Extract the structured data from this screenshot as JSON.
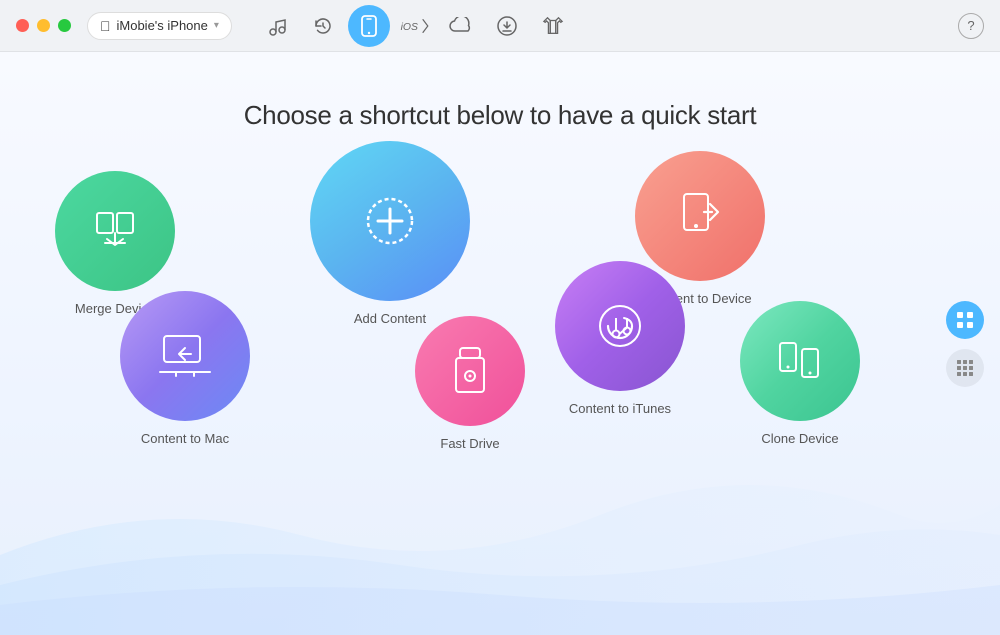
{
  "titlebar": {
    "device_name": "iMobie's iPhone",
    "chevron": "▾",
    "help_label": "?"
  },
  "toolbar": {
    "buttons": [
      {
        "id": "music",
        "label": "♫",
        "active": false,
        "symbol": "music"
      },
      {
        "id": "history",
        "label": "↺",
        "active": false,
        "symbol": "history"
      },
      {
        "id": "device",
        "label": "📱",
        "active": true,
        "symbol": "device"
      },
      {
        "id": "ios",
        "label": "iOS",
        "active": false,
        "symbol": "ios"
      },
      {
        "id": "cloud",
        "label": "☁",
        "active": false,
        "symbol": "cloud"
      },
      {
        "id": "download",
        "label": "↓",
        "active": false,
        "symbol": "download"
      },
      {
        "id": "transfer",
        "label": "⊡",
        "active": false,
        "symbol": "transfer"
      }
    ]
  },
  "main": {
    "page_title": "Choose a shortcut below to have a quick start",
    "shortcuts": [
      {
        "id": "merge-device",
        "label": "Merge Device",
        "gradient_from": "#4cd8a0",
        "gradient_to": "#3cc485"
      },
      {
        "id": "add-content",
        "label": "Add Content",
        "gradient_from": "#5dd6f0",
        "gradient_to": "#5b8ff7"
      },
      {
        "id": "content-to-device",
        "label": "Content to Device",
        "gradient_from": "#f9a090",
        "gradient_to": "#f0706a"
      },
      {
        "id": "content-to-mac",
        "label": "Content to Mac",
        "gradient_from": "#b89af5",
        "gradient_to": "#6b8af5"
      },
      {
        "id": "fast-drive",
        "label": "Fast Drive",
        "gradient_from": "#f97bb0",
        "gradient_to": "#f0509a"
      },
      {
        "id": "content-to-itunes",
        "label": "Content to iTunes",
        "gradient_from": "#c87ff5",
        "gradient_to": "#8855d0"
      },
      {
        "id": "clone-device",
        "label": "Clone Device",
        "gradient_from": "#7de8c0",
        "gradient_to": "#3bc490"
      }
    ]
  },
  "sidebar_right": {
    "buttons": [
      {
        "id": "tools",
        "active": true
      },
      {
        "id": "grid",
        "active": false
      }
    ]
  }
}
